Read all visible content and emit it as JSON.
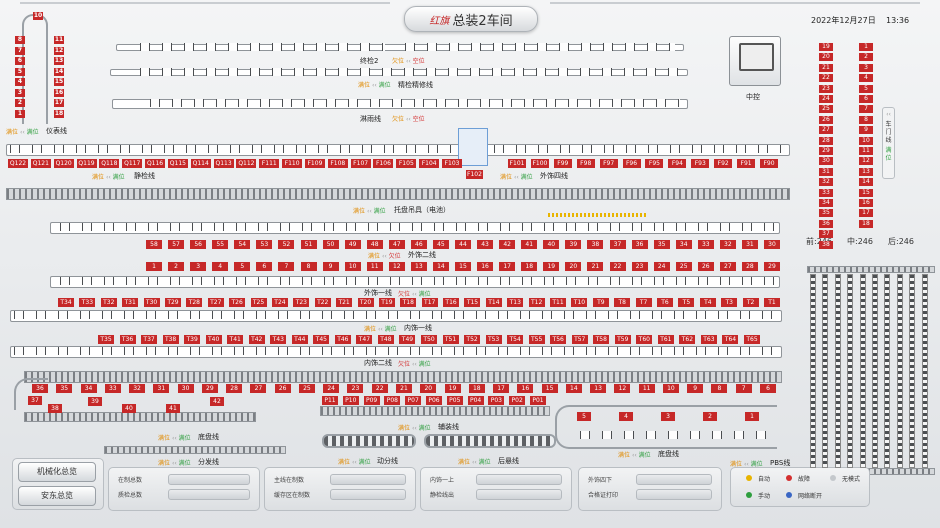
{
  "header": {
    "title": "总装2车间",
    "logo_text": "红旗",
    "date": "2022年12月27日",
    "time": "13:36"
  },
  "states": {
    "full": "满位",
    "empty": "空位",
    "short": "欠位"
  },
  "lines": {
    "ybx": "仪表线",
    "zhongkong": "中控",
    "jx2": "终检2",
    "jxjx": "精检精修线",
    "lyx": "淋雨线",
    "jjx": "静检线",
    "wsslx": "外饰四线",
    "tdj": "托盘吊具（电池）",
    "ws2": "外饰二线",
    "ws1": "外饰一线",
    "ns1": "内饰一线",
    "ns2": "内饰二线",
    "fzx": "辅装线",
    "dpx": "底盘线",
    "fpx": "分发线",
    "ddx": "动分线",
    "hxx": "后悬线",
    "dpx2": "底盘线",
    "pbs": "PBS线",
    "cmx": "车门线"
  },
  "left_loop": {
    "top": "10",
    "left": [
      "8",
      "7",
      "6",
      "5",
      "4",
      "3",
      "2",
      "1"
    ],
    "right": [
      "11",
      "12",
      "13",
      "14",
      "15",
      "16",
      "17",
      "18"
    ]
  },
  "row_q": [
    "Q122",
    "Q121",
    "Q120",
    "Q119",
    "Q118",
    "Q117",
    "Q116",
    "Q115",
    "Q114",
    "Q113",
    "Q112",
    "F111",
    "F110",
    "F109",
    "F108",
    "F107",
    "F106",
    "F105",
    "F104",
    "F103"
  ],
  "row_q_gap": "F102",
  "row_f": [
    "F101",
    "F100",
    "F99",
    "F98",
    "F97",
    "F96",
    "F95",
    "F94",
    "F93",
    "F92",
    "F91",
    "F90"
  ],
  "row_58": [
    "58",
    "57",
    "56",
    "55",
    "54",
    "53",
    "52",
    "51",
    "50",
    "49",
    "48",
    "47",
    "46",
    "45",
    "44",
    "43",
    "42",
    "41",
    "40",
    "39",
    "38",
    "37",
    "36",
    "35",
    "34",
    "33",
    "32",
    "31",
    "30"
  ],
  "row_1": [
    "1",
    "2",
    "3",
    "4",
    "5",
    "6",
    "7",
    "8",
    "9",
    "10",
    "11",
    "12",
    "13",
    "14",
    "15",
    "16",
    "17",
    "18",
    "19",
    "20",
    "21",
    "22",
    "23",
    "24",
    "25",
    "26",
    "27",
    "28",
    "29"
  ],
  "row_t": [
    "T34",
    "T33",
    "T32",
    "T31",
    "T30",
    "T29",
    "T28",
    "T27",
    "T26",
    "T25",
    "T24",
    "T23",
    "T22",
    "T21",
    "T20",
    "T19",
    "T18",
    "T17",
    "T16",
    "T15",
    "T14",
    "T13",
    "T12",
    "T11",
    "T10",
    "T9",
    "T8",
    "T7",
    "T6",
    "T5",
    "T4",
    "T3",
    "T2",
    "T1"
  ],
  "row_t2": [
    "T35",
    "T36",
    "T37",
    "T38",
    "T39",
    "T40",
    "T41",
    "T42",
    "T43",
    "T44",
    "T45",
    "T46",
    "T47",
    "T48",
    "T49",
    "T50",
    "T51",
    "T52",
    "T53",
    "T54",
    "T55",
    "T56",
    "T57",
    "T58",
    "T59",
    "T60",
    "T61",
    "T62",
    "T63",
    "T64",
    "T65"
  ],
  "row_36": [
    "36",
    "35",
    "34",
    "33",
    "32",
    "31",
    "30",
    "29",
    "28",
    "27",
    "26",
    "25",
    "24",
    "23",
    "22",
    "21",
    "20",
    "19",
    "18",
    "17",
    "16",
    "15",
    "14",
    "13",
    "12",
    "11",
    "10",
    "9",
    "8",
    "7",
    "6"
  ],
  "row_p": [
    "P11",
    "P10",
    "P09",
    "P08",
    "P07",
    "P06",
    "P05",
    "P04",
    "P03",
    "P02",
    "P01"
  ],
  "chassis": [
    "37",
    "38",
    "39",
    "40",
    "41",
    "42"
  ],
  "right_chassis": [
    "5",
    "4",
    "3",
    "2",
    "1"
  ],
  "right_grid_left": [
    "19",
    "20",
    "21",
    "22",
    "23",
    "24",
    "25",
    "26",
    "27",
    "28",
    "29",
    "30",
    "31",
    "32",
    "33",
    "34",
    "35",
    "36",
    "37",
    "38"
  ],
  "right_grid_right": [
    "1",
    "2",
    "3",
    "4",
    "5",
    "6",
    "7",
    "8",
    "9",
    "10",
    "11",
    "12",
    "13",
    "14",
    "15",
    "16",
    "17",
    "18"
  ],
  "tails": {
    "front": "前:246",
    "mid": "中:246",
    "back": "后:246"
  },
  "buttons": {
    "mech": "机械化总览",
    "safety": "安东总览"
  },
  "stats": {
    "zaizhi": "在制总数",
    "zhisun": "质检总数",
    "zhuxian": "主线在制数",
    "huancun": "缓存区在制数",
    "neishang": "内饰一上",
    "jingjian": "静检线出",
    "waishi": "外饰四下",
    "hege": "合格证打印"
  },
  "legend": {
    "auto": "自动",
    "fault": "故障",
    "nomode": "无模式",
    "manual": "手动",
    "offline": "网络断开"
  },
  "colors": {
    "red": "#c62828",
    "orange": "#e08a00",
    "green": "#2e9e3e"
  }
}
